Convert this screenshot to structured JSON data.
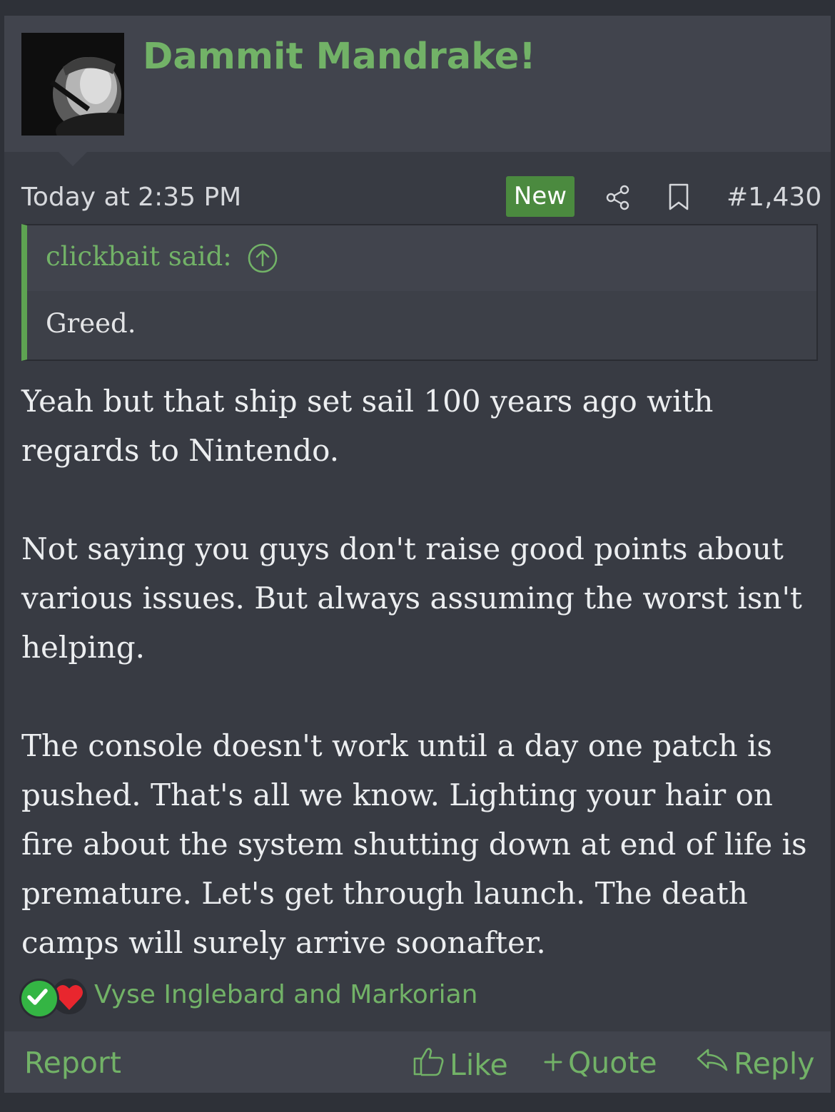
{
  "author": {
    "name": "Dammit Mandrake!"
  },
  "meta": {
    "date": "Today at 2:35 PM",
    "badge": "New",
    "post_number": "#1,430"
  },
  "quote": {
    "author_said": "clickbait said:",
    "text": "Greed."
  },
  "body": {
    "paragraphs": [
      "Yeah but that ship set sail 100 years ago with regards to Nintendo.",
      "Not saying you guys don't raise good points about various issues. But always assuming the worst isn't helping.",
      "The console doesn't work until a day one patch is pushed. That's all we know. Lighting your hair on fire about the system shutting down at end of life is premature. Let's get through launch. The death camps will surely arrive soonafter."
    ]
  },
  "reactions": {
    "users": "Vyse Inglebard and Markorian"
  },
  "footer": {
    "report": "Report",
    "like": "Like",
    "quote": "Quote",
    "reply": "Reply"
  },
  "colors": {
    "accent": "#72b267",
    "badge": "#4b8a3f",
    "background": "#383b43",
    "header": "#41444d"
  }
}
